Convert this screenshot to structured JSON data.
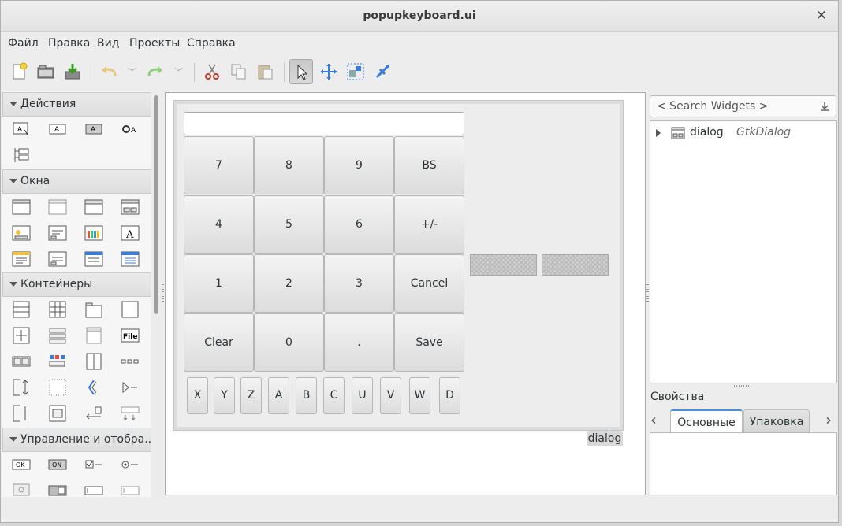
{
  "window": {
    "title": "popupkeyboard.ui"
  },
  "menu": [
    "Файл",
    "Правка",
    "Вид",
    "Проекты",
    "Справка"
  ],
  "toolbar": {
    "buttons": [
      "new-file-icon",
      "open-folder-icon",
      "save-icon",
      "undo-icon",
      "redo-icon",
      "cut-icon",
      "copy-icon",
      "paste-icon",
      "pointer-icon",
      "drag-resize-icon",
      "align-icon",
      "pin-icon"
    ],
    "active": "pointer-icon"
  },
  "palette": {
    "sections": [
      {
        "label": "Действия"
      },
      {
        "label": "Окна"
      },
      {
        "label": "Контейнеры"
      },
      {
        "label": "Управление и отобра..."
      }
    ],
    "file_icon_text": "File",
    "ok_icon_text": "OK",
    "on_icon_text": "ON"
  },
  "designer": {
    "keys": [
      [
        "7",
        "8",
        "9",
        "BS"
      ],
      [
        "4",
        "5",
        "6",
        "+/-"
      ],
      [
        "1",
        "2",
        "3",
        "Cancel"
      ],
      [
        "Clear",
        "0",
        ".",
        "Save"
      ]
    ],
    "letter_keys": [
      "X",
      "Y",
      "Z",
      "A",
      "B",
      "C",
      "U",
      "V",
      "W",
      "D"
    ],
    "dialog_tag": "dialog"
  },
  "widget_tree": {
    "search_placeholder": "< Search Widgets >",
    "rows": [
      {
        "name": "dialog",
        "type": "GtkDialog"
      }
    ]
  },
  "properties": {
    "title": "Свойства",
    "tabs": [
      "Основные",
      "Упаковка"
    ],
    "selected_tab": "Основные"
  }
}
